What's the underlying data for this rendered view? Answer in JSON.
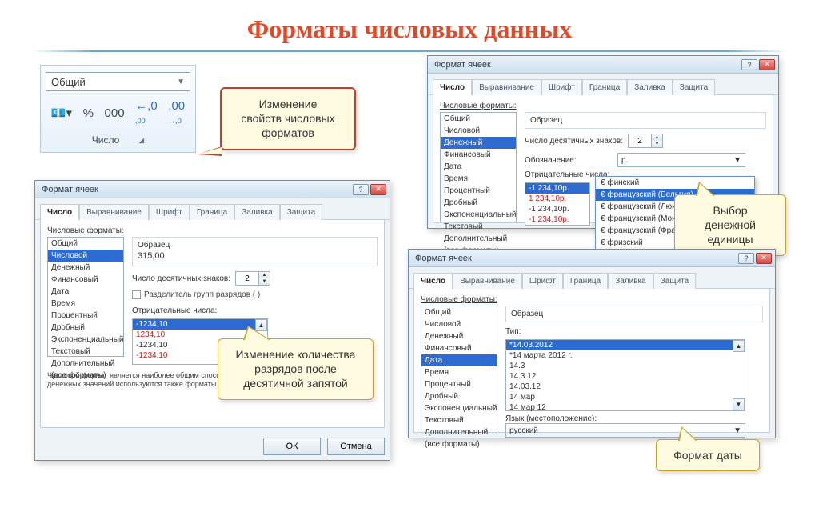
{
  "title": "Форматы числовых данных",
  "ribbon": {
    "format_value": "Общий",
    "group_label": "Число"
  },
  "callouts": {
    "c1": "Изменение\nсвойств числовых\nформатов",
    "c2": "Изменение количества\nразрядов после\nдесятичной запятой",
    "c3": "Выбор денежной\nединицы",
    "c4": "Формат даты"
  },
  "dialog": {
    "title": "Формат ячеек",
    "tabs": [
      "Число",
      "Выравнивание",
      "Шрифт",
      "Граница",
      "Заливка",
      "Защита"
    ],
    "left_label": "Числовые форматы:",
    "categories": [
      "Общий",
      "Числовой",
      "Денежный",
      "Финансовый",
      "Дата",
      "Время",
      "Процентный",
      "Дробный",
      "Экспоненциальный",
      "Текстовый",
      "Дополнительный",
      "(все форматы)"
    ],
    "sample_label": "Образец",
    "decimals_label": "Число десятичных знаков:",
    "decimals_value": "2",
    "group_sep": "Разделитель групп разрядов ( )",
    "neg_label": "Отрицательные числа:",
    "symbol_label": "Обозначение:",
    "symbol_value": "р.",
    "type_label": "Тип:",
    "locale_label": "Язык (местоположение):",
    "locale_value": "русский",
    "ok": "ОК",
    "cancel": "Отмена"
  },
  "dlg1": {
    "sample_value": "315,00",
    "selected_cat": "Числовой",
    "neg_options": [
      "-1234,10",
      "1234,10",
      "-1234,10",
      "-1234,10"
    ],
    "desc": "Числовой формат является наиболее общим способом представления чисел. Для вывода денежных значений используются также форматы \"Денежный\" и \"Финансовый\"."
  },
  "dlg2": {
    "selected_cat": "Денежный",
    "neg_options": [
      "-1 234,10р.",
      "1 234,10р.",
      "-1 234,10р.",
      "-1 234,10р."
    ],
    "currency_options": [
      "€ финский",
      "€ французский (Бельгия)",
      "€ французский (Люксембург)",
      "€ французский (Монако)",
      "€ французский (Франция)",
      "€ фризский"
    ]
  },
  "dlg3": {
    "selected_cat": "Дата",
    "type_options": [
      "*14.03.2012",
      "*14 марта 2012 г.",
      "14.3",
      "14.3.12",
      "14.03.12",
      "14 мар",
      "14 мар 12"
    ]
  }
}
